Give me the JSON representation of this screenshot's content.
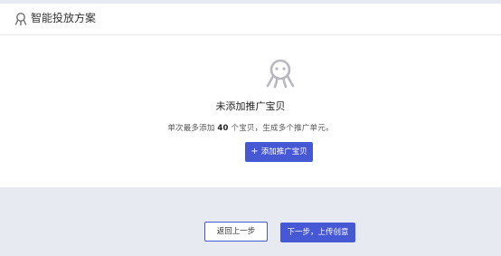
{
  "header": {
    "title": "智能投放方案",
    "icon": "smart-plan-icon"
  },
  "empty_state": {
    "icon": "octopus-mascot-icon",
    "title": "未添加推广宝贝",
    "desc_prefix": "单次最多添加 ",
    "desc_count": "40",
    "desc_suffix": " 个宝贝，生成多个推广单元。",
    "add_button": {
      "icon": "+",
      "label": "添加推广宝贝"
    }
  },
  "footer": {
    "back_label": "返回上一步",
    "next_label": "下一步，上传创意"
  },
  "colors": {
    "primary": "#4758d4",
    "page_bg": "#e8eaf1",
    "card_bg": "#ffffff"
  }
}
